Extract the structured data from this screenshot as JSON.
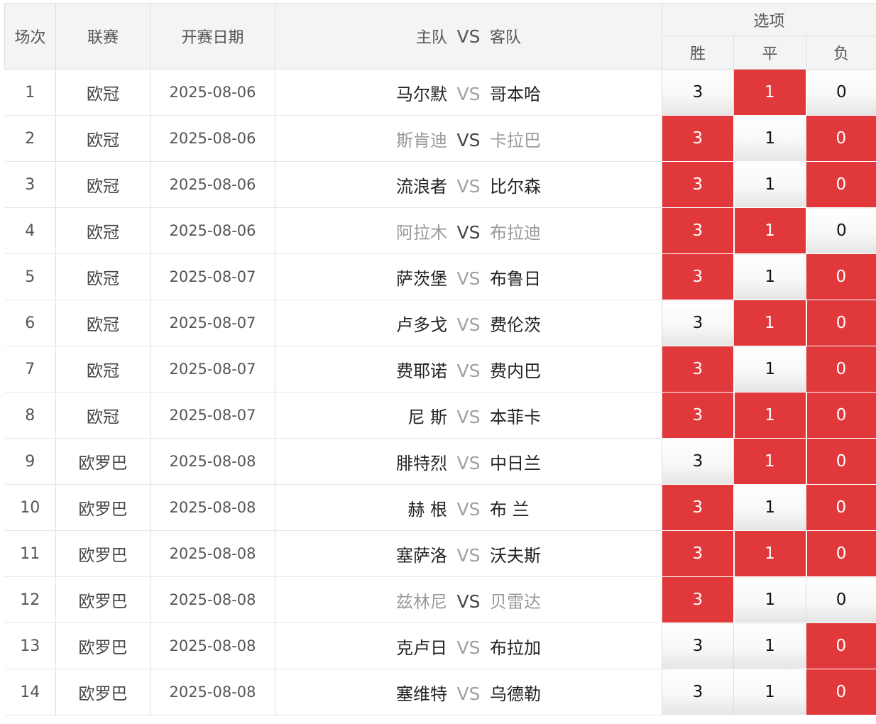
{
  "header": {
    "col_index": "场次",
    "col_league": "联赛",
    "col_date": "开赛日期",
    "col_home": "主队",
    "col_vs": "VS",
    "col_away": "客队",
    "col_options": "选项",
    "opt_win": "胜",
    "opt_draw": "平",
    "opt_loss": "负"
  },
  "colors": {
    "selected": "#e1393b",
    "dark_team": "#222222",
    "grey_team": "#9a9a9a"
  },
  "matches": [
    {
      "index": "1",
      "league": "欧冠",
      "date": "2025-08-06",
      "home": "马尔默",
      "vs": "VS",
      "away": "哥本哈",
      "teams_grey": false,
      "vs_grey": true,
      "win": "3",
      "draw": "1",
      "loss": "0",
      "win_sel": false,
      "draw_sel": true,
      "loss_sel": false
    },
    {
      "index": "2",
      "league": "欧冠",
      "date": "2025-08-06",
      "home": "斯肯迪",
      "vs": "VS",
      "away": "卡拉巴",
      "teams_grey": true,
      "vs_grey": false,
      "win": "3",
      "draw": "1",
      "loss": "0",
      "win_sel": true,
      "draw_sel": false,
      "loss_sel": true
    },
    {
      "index": "3",
      "league": "欧冠",
      "date": "2025-08-06",
      "home": "流浪者",
      "vs": "VS",
      "away": "比尔森",
      "teams_grey": false,
      "vs_grey": true,
      "win": "3",
      "draw": "1",
      "loss": "0",
      "win_sel": true,
      "draw_sel": false,
      "loss_sel": true
    },
    {
      "index": "4",
      "league": "欧冠",
      "date": "2025-08-06",
      "home": "阿拉木",
      "vs": "VS",
      "away": "布拉迪",
      "teams_grey": true,
      "vs_grey": false,
      "win": "3",
      "draw": "1",
      "loss": "0",
      "win_sel": true,
      "draw_sel": true,
      "loss_sel": false
    },
    {
      "index": "5",
      "league": "欧冠",
      "date": "2025-08-07",
      "home": "萨茨堡",
      "vs": "VS",
      "away": "布鲁日",
      "teams_grey": false,
      "vs_grey": true,
      "win": "3",
      "draw": "1",
      "loss": "0",
      "win_sel": true,
      "draw_sel": false,
      "loss_sel": true
    },
    {
      "index": "6",
      "league": "欧冠",
      "date": "2025-08-07",
      "home": "卢多戈",
      "vs": "VS",
      "away": "费伦茨",
      "teams_grey": false,
      "vs_grey": true,
      "win": "3",
      "draw": "1",
      "loss": "0",
      "win_sel": false,
      "draw_sel": true,
      "loss_sel": true
    },
    {
      "index": "7",
      "league": "欧冠",
      "date": "2025-08-07",
      "home": "费耶诺",
      "vs": "VS",
      "away": "费内巴",
      "teams_grey": false,
      "vs_grey": true,
      "win": "3",
      "draw": "1",
      "loss": "0",
      "win_sel": true,
      "draw_sel": false,
      "loss_sel": true
    },
    {
      "index": "8",
      "league": "欧冠",
      "date": "2025-08-07",
      "home": "尼 斯",
      "vs": "VS",
      "away": "本菲卡",
      "teams_grey": false,
      "vs_grey": true,
      "win": "3",
      "draw": "1",
      "loss": "0",
      "win_sel": true,
      "draw_sel": true,
      "loss_sel": true
    },
    {
      "index": "9",
      "league": "欧罗巴",
      "date": "2025-08-08",
      "home": "腓特烈",
      "vs": "VS",
      "away": "中日兰",
      "teams_grey": false,
      "vs_grey": true,
      "win": "3",
      "draw": "1",
      "loss": "0",
      "win_sel": false,
      "draw_sel": true,
      "loss_sel": true
    },
    {
      "index": "10",
      "league": "欧罗巴",
      "date": "2025-08-08",
      "home": "赫 根",
      "vs": "VS",
      "away": "布 兰",
      "teams_grey": false,
      "vs_grey": true,
      "win": "3",
      "draw": "1",
      "loss": "0",
      "win_sel": true,
      "draw_sel": false,
      "loss_sel": true
    },
    {
      "index": "11",
      "league": "欧罗巴",
      "date": "2025-08-08",
      "home": "塞萨洛",
      "vs": "VS",
      "away": "沃夫斯",
      "teams_grey": false,
      "vs_grey": true,
      "win": "3",
      "draw": "1",
      "loss": "0",
      "win_sel": true,
      "draw_sel": true,
      "loss_sel": true
    },
    {
      "index": "12",
      "league": "欧罗巴",
      "date": "2025-08-08",
      "home": "兹林尼",
      "vs": "VS",
      "away": "贝雷达",
      "teams_grey": true,
      "vs_grey": false,
      "win": "3",
      "draw": "1",
      "loss": "0",
      "win_sel": true,
      "draw_sel": false,
      "loss_sel": false
    },
    {
      "index": "13",
      "league": "欧罗巴",
      "date": "2025-08-08",
      "home": "克卢日",
      "vs": "VS",
      "away": "布拉加",
      "teams_grey": false,
      "vs_grey": true,
      "win": "3",
      "draw": "1",
      "loss": "0",
      "win_sel": false,
      "draw_sel": false,
      "loss_sel": true
    },
    {
      "index": "14",
      "league": "欧罗巴",
      "date": "2025-08-08",
      "home": "塞维特",
      "vs": "VS",
      "away": "乌德勒",
      "teams_grey": false,
      "vs_grey": true,
      "win": "3",
      "draw": "1",
      "loss": "0",
      "win_sel": false,
      "draw_sel": false,
      "loss_sel": true
    }
  ]
}
